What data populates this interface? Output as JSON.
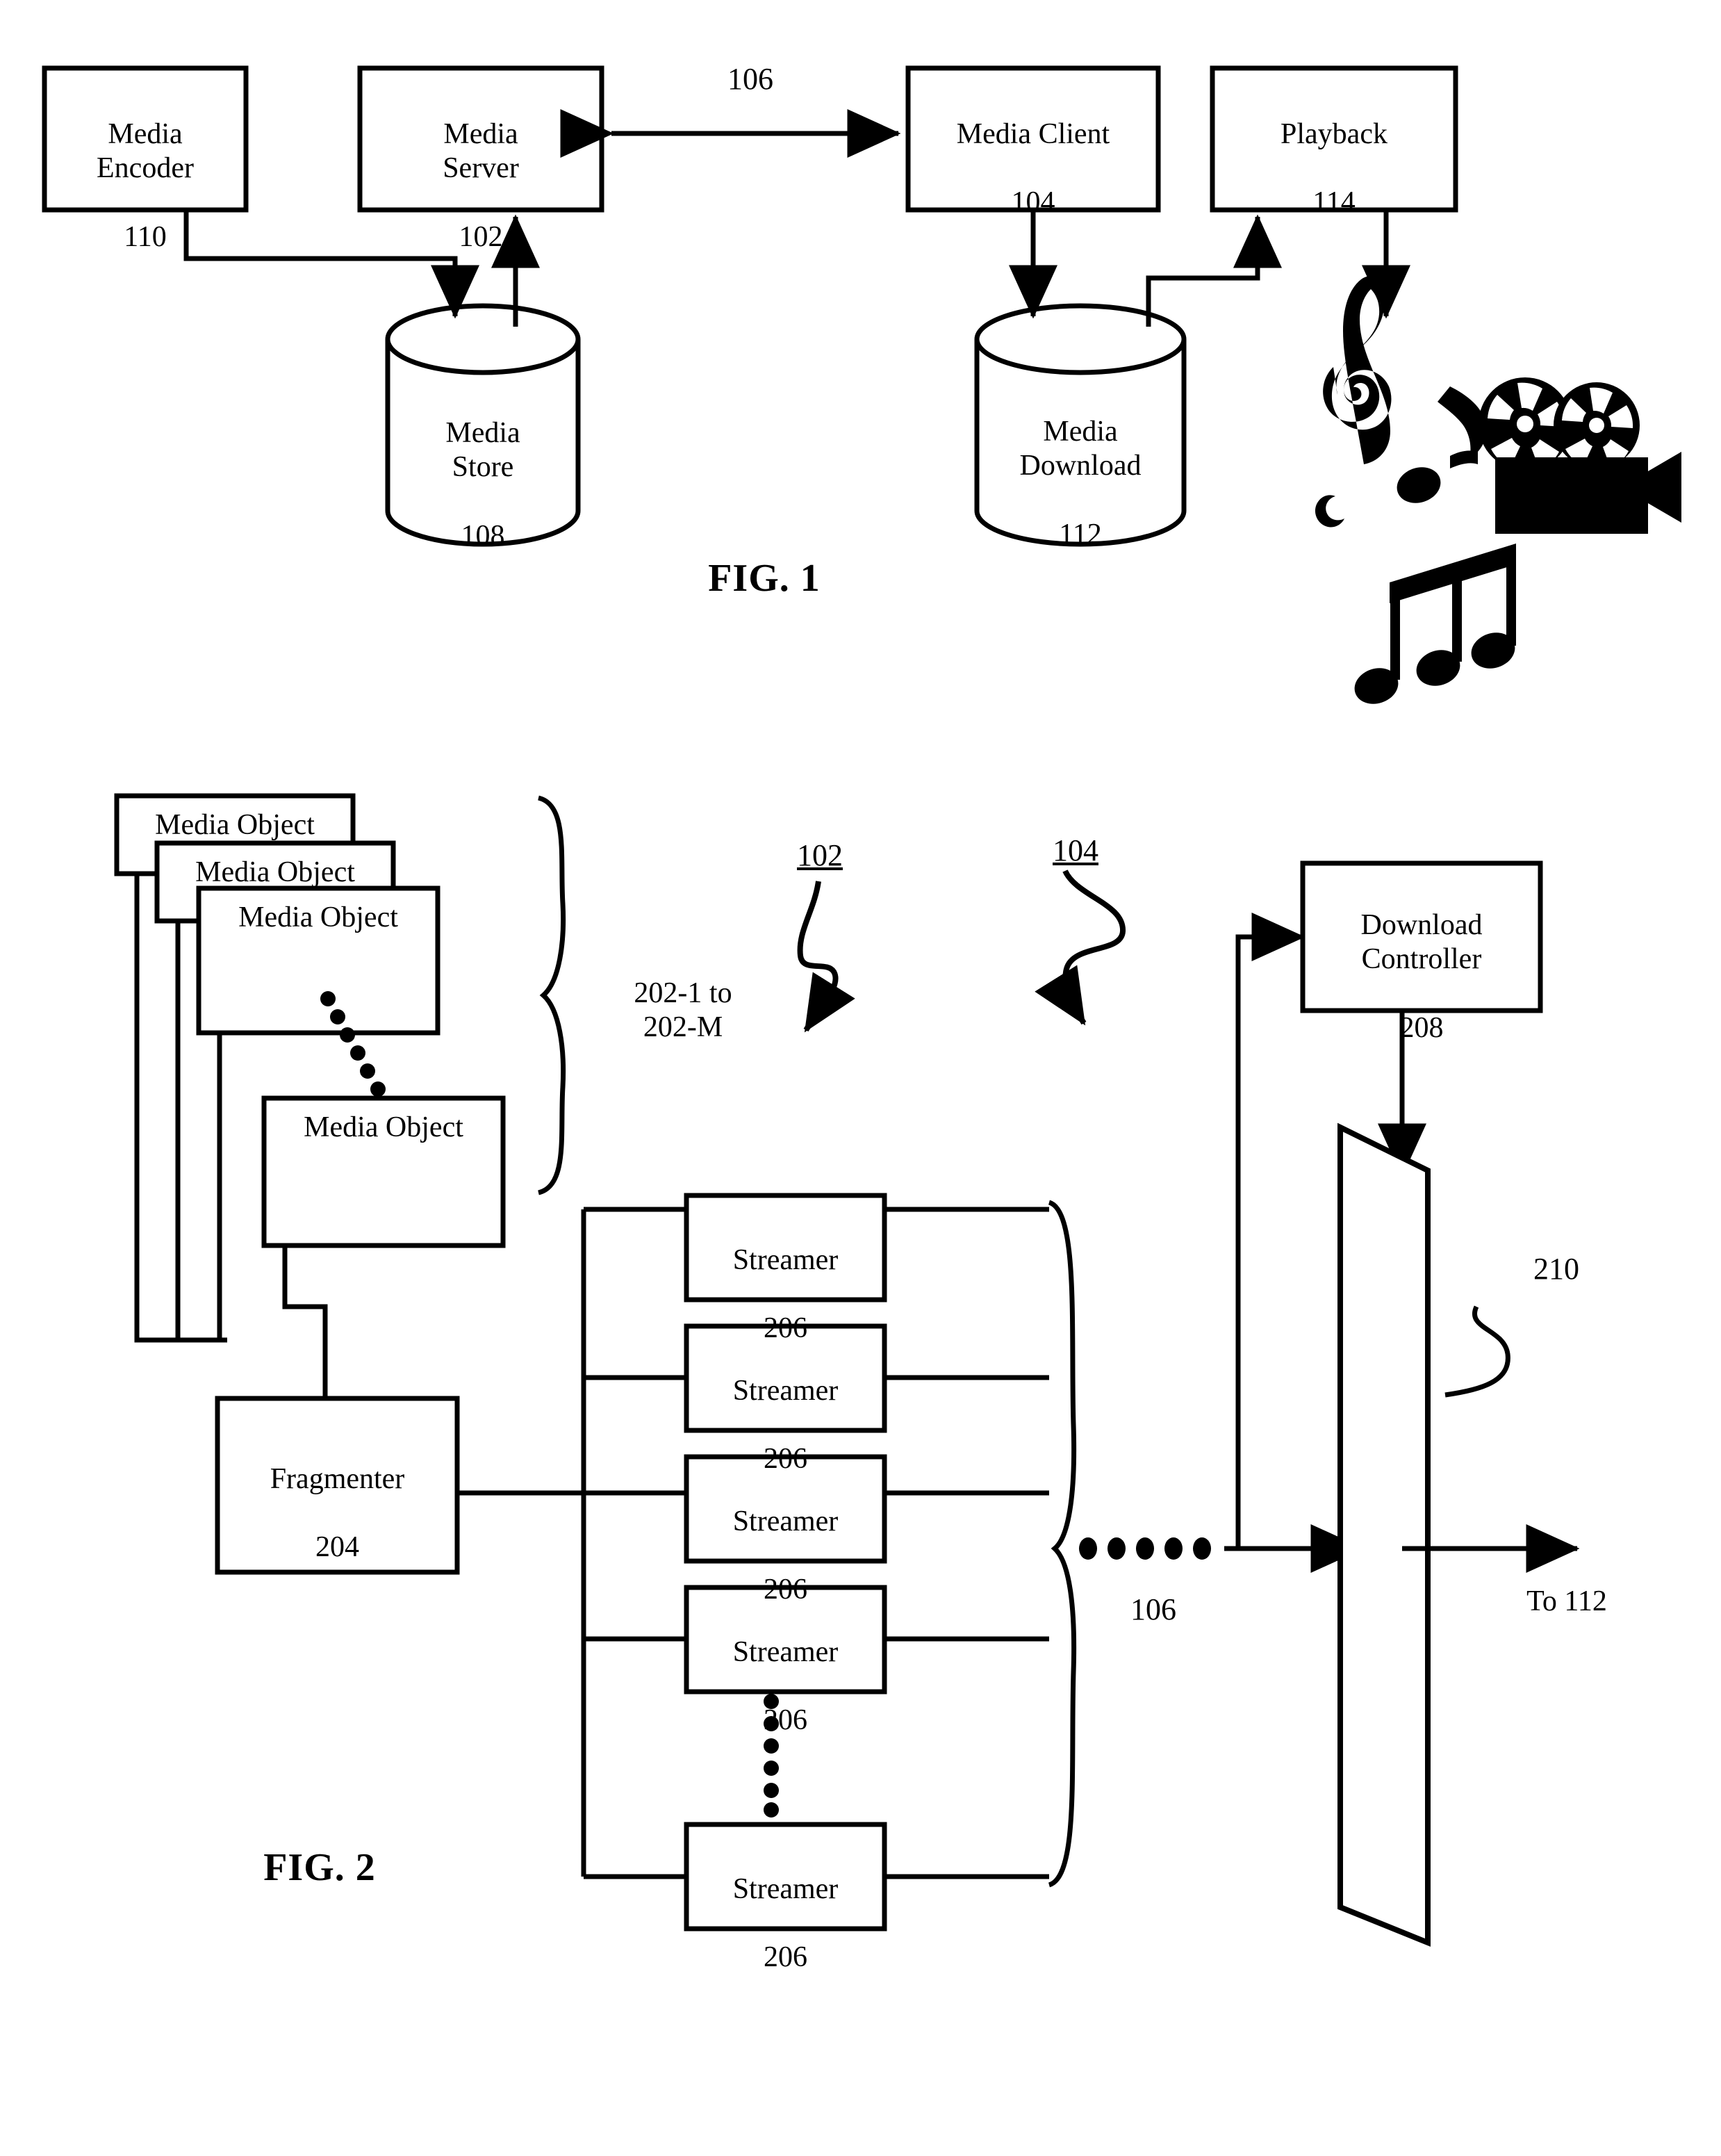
{
  "document": {
    "type": "patent-drawing-sheet",
    "figures": [
      "FIG. 1",
      "FIG. 2"
    ]
  },
  "fig1": {
    "caption": "FIG. 1",
    "boxes": [
      {
        "id": "media-encoder",
        "title": "Media\nEncoder",
        "ref": "110"
      },
      {
        "id": "media-server",
        "title": "Media\nServer",
        "ref": "102"
      },
      {
        "id": "media-client",
        "title": "Media Client",
        "ref": "104"
      },
      {
        "id": "playback",
        "title": "Playback",
        "ref": "114"
      }
    ],
    "cylinders": [
      {
        "id": "media-store",
        "title": "Media\nStore",
        "ref": "108"
      },
      {
        "id": "media-download",
        "title": "Media\nDownload",
        "ref": "112"
      }
    ],
    "link_labels": [
      {
        "id": "network-link",
        "text": "106"
      }
    ],
    "icons": [
      {
        "id": "music-notes-icon",
        "name": "music-notes-icon"
      },
      {
        "id": "film-projector-icon",
        "name": "film-projector-icon"
      }
    ]
  },
  "fig2": {
    "caption": "FIG. 2",
    "media_objects": [
      {
        "label": "Media Object"
      },
      {
        "label": "Media Object"
      },
      {
        "label": "Media Object"
      },
      {
        "label": "Media Object"
      }
    ],
    "brace_label": "202-1 to\n202-M",
    "server_ref": "102",
    "client_ref": "104",
    "boxes": [
      {
        "id": "fragmenter",
        "title": "Fragmenter",
        "ref": "204"
      },
      {
        "id": "download-controller",
        "title": "Download\nController",
        "ref": "208"
      }
    ],
    "streamers": [
      {
        "title": "Streamer",
        "ref": "206"
      },
      {
        "title": "Streamer",
        "ref": "206"
      },
      {
        "title": "Streamer",
        "ref": "206"
      },
      {
        "title": "Streamer",
        "ref": "206"
      },
      {
        "title": "Streamer",
        "ref": "206"
      }
    ],
    "network_label": "106",
    "parallelogram_ref": "210",
    "output_label": "To 112"
  },
  "style": {
    "ink": "#000000",
    "paper": "#ffffff"
  }
}
